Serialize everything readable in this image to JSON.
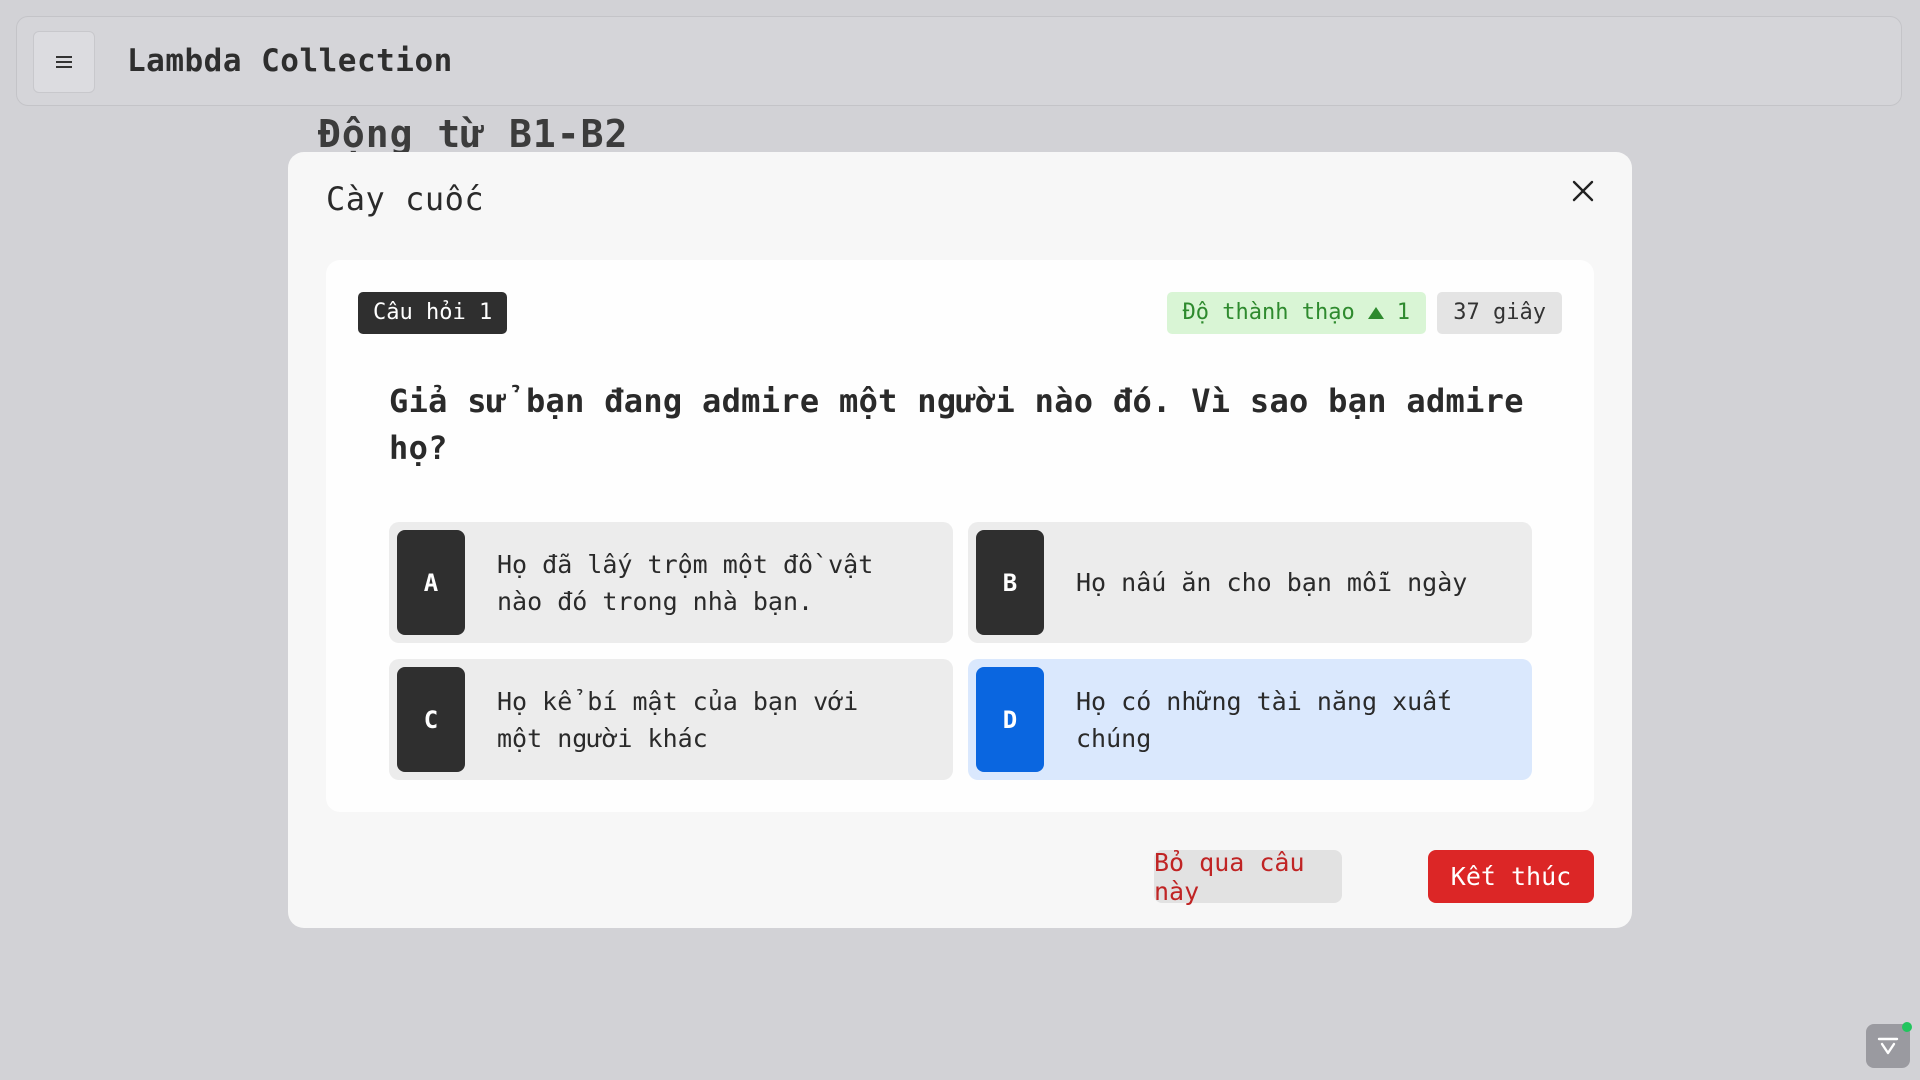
{
  "app": {
    "title": "Lambda Collection",
    "menu_icon": "hamburger-menu-icon"
  },
  "page": {
    "heading": "Động từ B1-B2"
  },
  "modal": {
    "title": "Cày cuốc",
    "close_icon": "close-icon",
    "question_label": "Câu hỏi 1",
    "mastery_label": "Độ thành thạo",
    "mastery_icon": "triangle-up-icon",
    "mastery_value": "1",
    "timer": "37 giây",
    "question_text": "Giả sử bạn đang admire một người nào đó. Vì sao bạn admire họ?",
    "options": [
      {
        "letter": "A",
        "text": "Họ đã lấy trộm một đồ vật nào đó trong nhà bạn.",
        "selected": false
      },
      {
        "letter": "B",
        "text": "Họ nấu ăn cho bạn mỗi ngày",
        "selected": false
      },
      {
        "letter": "C",
        "text": "Họ kể bí mật của bạn với một người khác",
        "selected": false
      },
      {
        "letter": "D",
        "text": "Họ có những tài năng xuất chúng",
        "selected": true
      }
    ],
    "skip_label": "Bỏ qua câu này",
    "end_label": "Kết thúc"
  },
  "colors": {
    "selected_accent": "#0a66e0",
    "selected_bg": "#dae8fd",
    "danger": "#dc2626",
    "mastery_green": "#2e8a2e"
  },
  "widget_icon": "assistant-widget-icon"
}
